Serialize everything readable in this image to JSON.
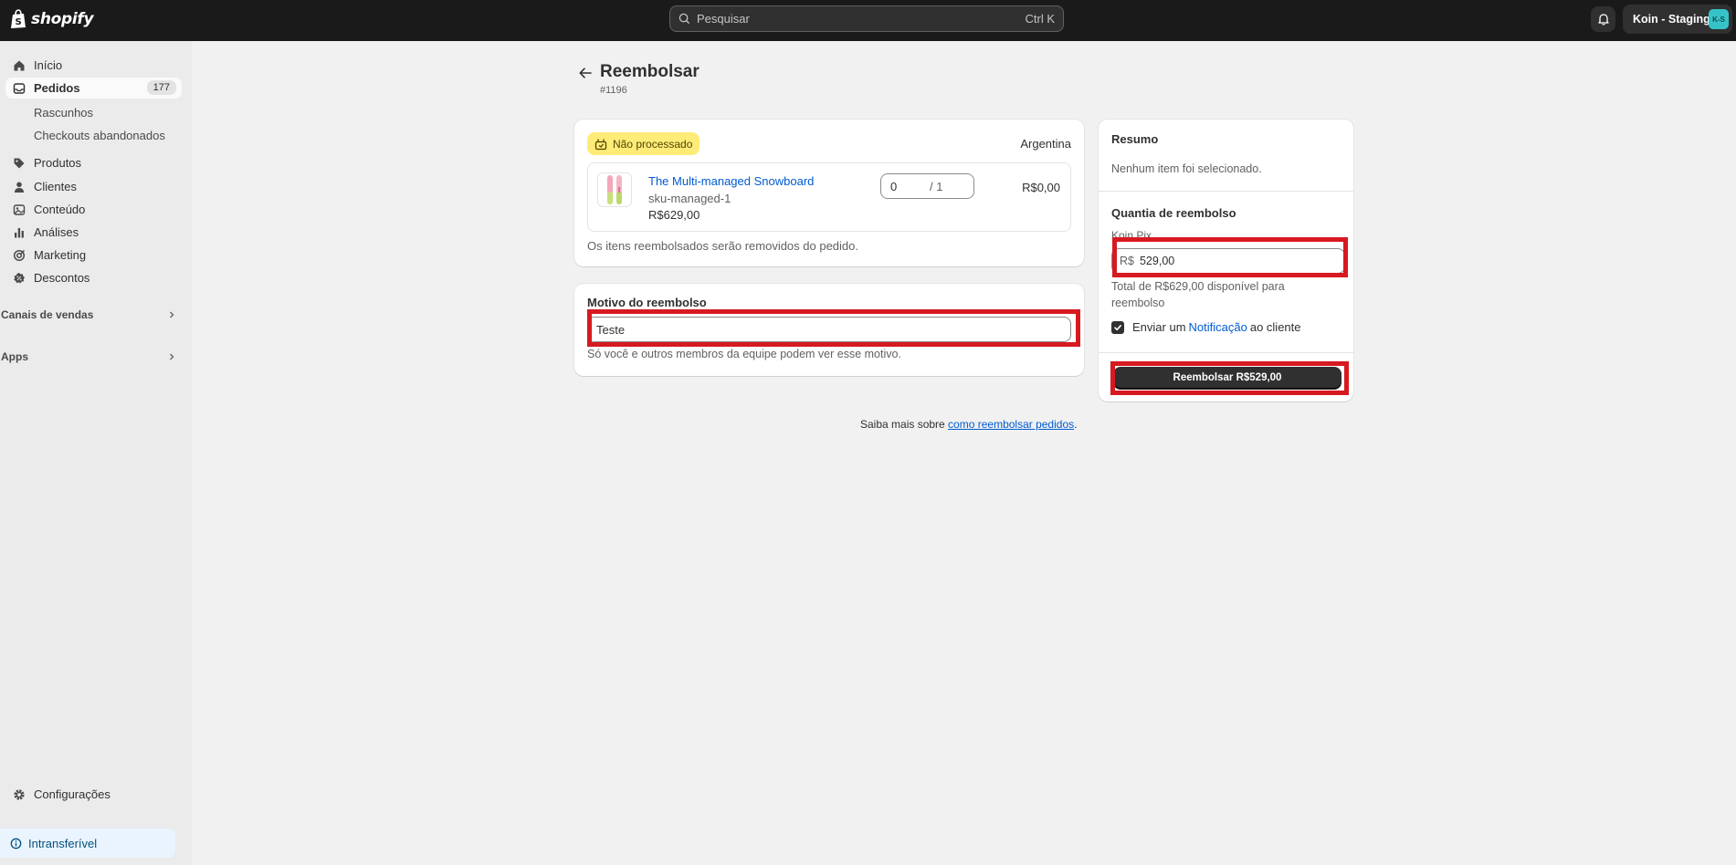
{
  "topbar": {
    "brand": "shopify",
    "search_placeholder": "Pesquisar",
    "search_shortcut": "Ctrl K",
    "store_name": "Koin - Staging",
    "store_initials": "K-S"
  },
  "sidebar": {
    "items": [
      {
        "label": "Início",
        "icon": "home-icon"
      },
      {
        "label": "Pedidos",
        "icon": "inbox-icon",
        "badge": "177",
        "active": true
      },
      {
        "label": "Produtos",
        "icon": "tag-icon"
      },
      {
        "label": "Clientes",
        "icon": "person-icon"
      },
      {
        "label": "Conteúdo",
        "icon": "content-icon"
      },
      {
        "label": "Análises",
        "icon": "bar-chart-icon"
      },
      {
        "label": "Marketing",
        "icon": "target-icon"
      },
      {
        "label": "Descontos",
        "icon": "discount-icon"
      }
    ],
    "sub_items": [
      "Rascunhos",
      "Checkouts abandonados"
    ],
    "sales_channels": "Canais de vendas",
    "apps": "Apps",
    "settings": "Configurações",
    "intransferivel": "Intransferível"
  },
  "page": {
    "title": "Reembolsar",
    "order_number": "#1196"
  },
  "items_card": {
    "status_badge": "Não processado",
    "location": "Argentina",
    "product_name": "The Multi-managed Snowboard",
    "sku": "sku-managed-1",
    "unit_price": "R$629,00",
    "qty_value": "0",
    "qty_total": "/ 1",
    "line_amount": "R$0,00",
    "note": "Os itens reembolsados serão removidos do pedido."
  },
  "reason_card": {
    "label": "Motivo do reembolso",
    "value": "Teste",
    "note": "Só você e outros membros da equipe podem ver esse motivo."
  },
  "learn_more": {
    "prefix": "Saiba mais sobre ",
    "link": "como reembolsar pedidos",
    "suffix": "."
  },
  "summary": {
    "title": "Resumo",
    "empty": "Nenhum item foi selecionado.",
    "amount_title": "Quantia de reembolso",
    "gateway": "Koin Pix",
    "currency_prefix": "R$",
    "amount_value": "529,00",
    "available": "Total de R$629,00 disponível para reembolso",
    "notify_prefix": "Enviar um",
    "notify_link": "Notificação",
    "notify_suffix": "ao cliente",
    "refund_button": "Reembolsar R$529,00"
  },
  "colors": {
    "highlight": "#d71920",
    "link": "#005bd3",
    "badge_attention": "#ffeb78"
  }
}
